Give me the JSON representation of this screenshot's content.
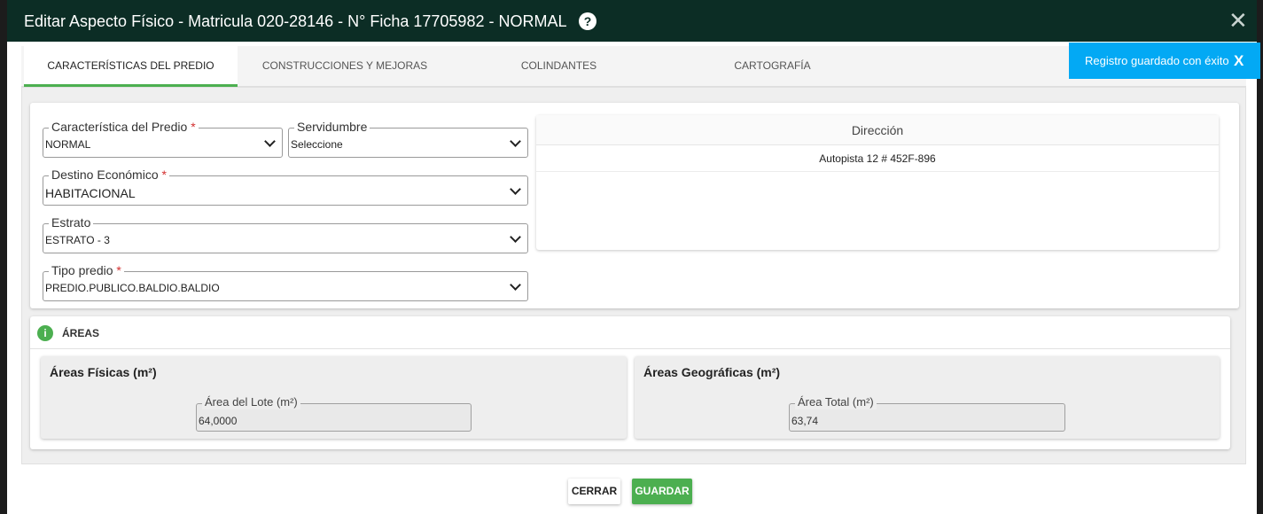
{
  "modal": {
    "title": "Editar Aspecto Físico - Matricula 020-28146 - N° Ficha 17705982 - NORMAL",
    "help_symbol": "?",
    "close_symbol": "✕"
  },
  "tabs": [
    {
      "label": "CARACTERÍSTICAS DEL PREDIO",
      "active": true
    },
    {
      "label": "CONSTRUCCIONES Y MEJORAS",
      "active": false
    },
    {
      "label": "COLINDANTES",
      "active": false
    },
    {
      "label": "CARTOGRAFÍA",
      "active": false
    }
  ],
  "toast": {
    "message": "Registro guardado con éxito",
    "close_symbol": "X"
  },
  "form": {
    "caracteristica": {
      "label": "Característica del Predio",
      "required_mark": "*",
      "value": "NORMAL"
    },
    "servidumbre": {
      "label": "Servidumbre",
      "value": "Seleccione"
    },
    "destino": {
      "label": "Destino Económico",
      "required_mark": "*",
      "value": "HABITACIONAL"
    },
    "estrato": {
      "label": "Estrato",
      "value": "ESTRATO - 3"
    },
    "tipo_predio": {
      "label": "Tipo predio",
      "required_mark": "*",
      "value": "PREDIO.PUBLICO.BALDIO.BALDIO"
    }
  },
  "direccion": {
    "header": "Dirección",
    "rows": [
      "Autopista 12 # 452F-896"
    ]
  },
  "areas": {
    "title": "ÁREAS",
    "info_symbol": "i",
    "fisicas": {
      "title": "Áreas Físicas (m²)",
      "field_label": "Área del Lote (m²)",
      "field_value": "64,0000"
    },
    "geograficas": {
      "title": "Áreas Geográficas (m²)",
      "field_label": "Área Total (m²)",
      "field_value": "63,74"
    }
  },
  "buttons": {
    "close_label": "CERRAR",
    "save_label": "GUARDAR"
  },
  "colors": {
    "header_bg": "#0c2d25",
    "accent_green": "#4caf50",
    "toast_blue": "#03a9f4",
    "required_red": "#d32f2f"
  }
}
